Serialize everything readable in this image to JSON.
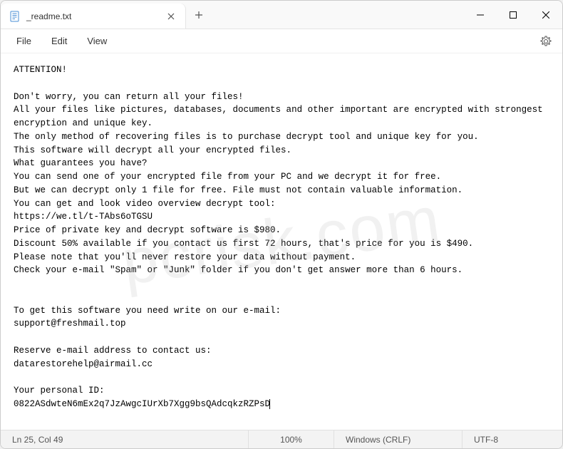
{
  "tab": {
    "title": "_readme.txt"
  },
  "menu": {
    "file": "File",
    "edit": "Edit",
    "view": "View"
  },
  "content": "ATTENTION!\n\nDon't worry, you can return all your files!\nAll your files like pictures, databases, documents and other important are encrypted with strongest encryption and unique key.\nThe only method of recovering files is to purchase decrypt tool and unique key for you.\nThis software will decrypt all your encrypted files.\nWhat guarantees you have?\nYou can send one of your encrypted file from your PC and we decrypt it for free.\nBut we can decrypt only 1 file for free. File must not contain valuable information.\nYou can get and look video overview decrypt tool:\nhttps://we.tl/t-TAbs6oTGSU\nPrice of private key and decrypt software is $980.\nDiscount 50% available if you contact us first 72 hours, that's price for you is $490.\nPlease note that you'll never restore your data without payment.\nCheck your e-mail \"Spam\" or \"Junk\" folder if you don't get answer more than 6 hours.\n\n\nTo get this software you need write on our e-mail:\nsupport@freshmail.top\n\nReserve e-mail address to contact us:\ndatarestorehelp@airmail.cc\n\nYour personal ID:\n0822ASdwteN6mEx2q7JzAwgcIUrXb7Xgg9bsQAdcqkzRZPsD",
  "status": {
    "position": "Ln 25, Col 49",
    "zoom": "100%",
    "eol": "Windows (CRLF)",
    "encoding": "UTF-8"
  },
  "watermark": "pcrisk.com"
}
